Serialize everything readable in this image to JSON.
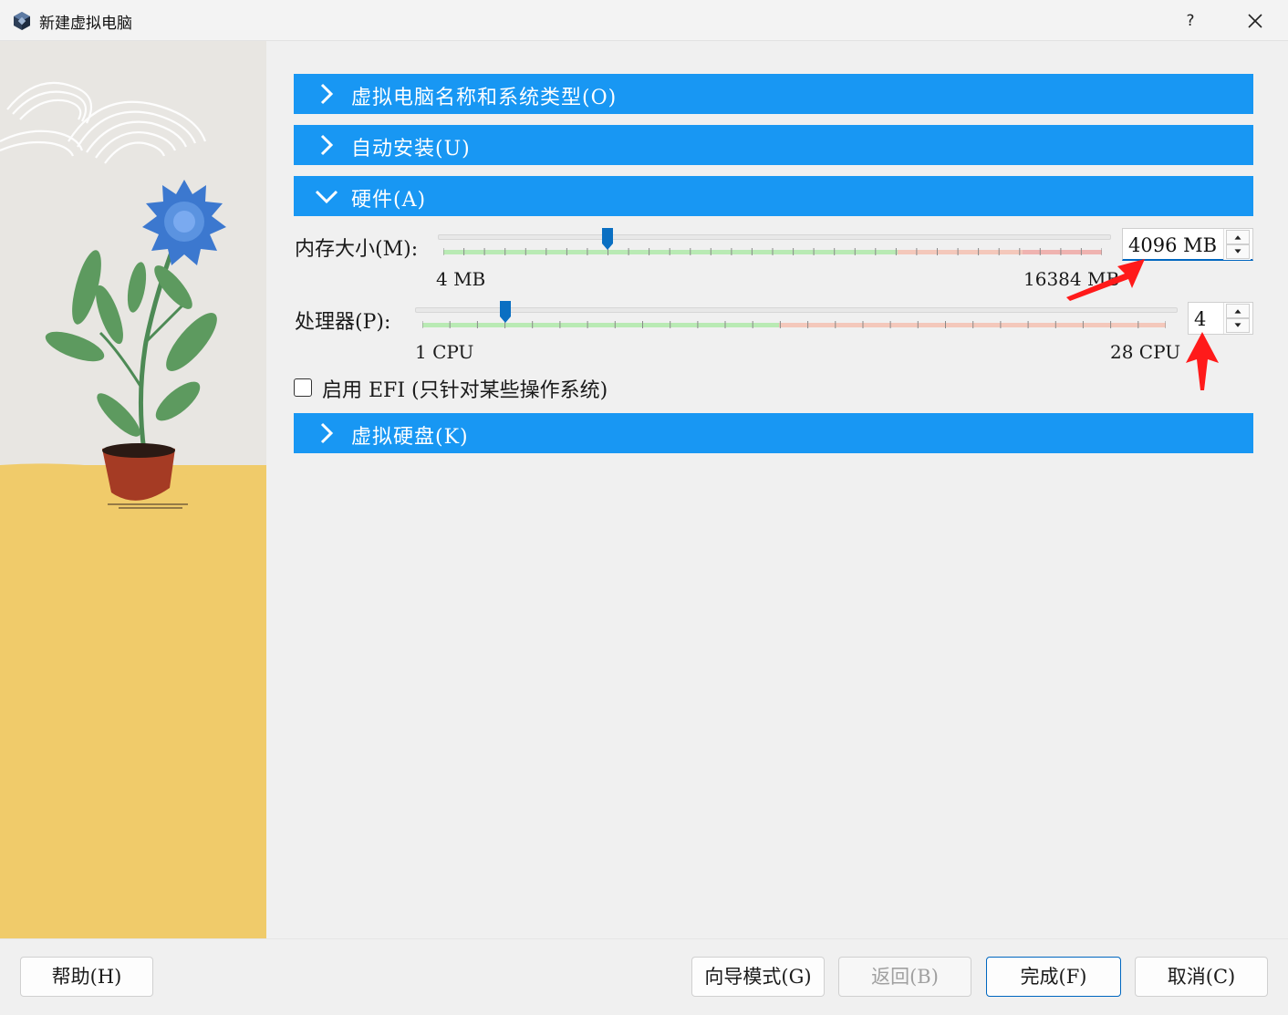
{
  "window": {
    "title": "新建虚拟电脑",
    "help": "?",
    "app_icon": "virtualbox-icon",
    "close_icon": "close-icon"
  },
  "sections": {
    "name_os": "虚拟电脑名称和系统类型(O)",
    "unattended": "自动安装(U)",
    "hardware": "硬件(A)",
    "disk": "虚拟硬盘(K)"
  },
  "hardware": {
    "memory": {
      "label": "内存大小(M):",
      "value": "4096 MB",
      "min_label": "4 MB",
      "max_label": "16384 MB",
      "min": 4,
      "max": 16384,
      "current": 4096,
      "recommended_fraction": 0.69
    },
    "cpu": {
      "label": "处理器(P):",
      "value": "4",
      "min_label": "1 CPU",
      "max_label": "28 CPU",
      "min": 1,
      "max": 28,
      "current": 4,
      "recommended_fraction": 0.48
    },
    "efi": {
      "label": "启用 EFI (只针对某些操作系统)",
      "checked": false
    }
  },
  "footer": {
    "help": "帮助(H)",
    "guided": "向导模式(G)",
    "back": "返回(B)",
    "finish": "完成(F)",
    "cancel": "取消(C)"
  },
  "colors": {
    "section_header": "#1897f3",
    "range_good": "#b9eab4",
    "range_warn": "#f4c8bb",
    "range_bad": "#efb3b0",
    "thumb": "#0a6fc2",
    "annotation_arrow": "#ff1a1a"
  }
}
